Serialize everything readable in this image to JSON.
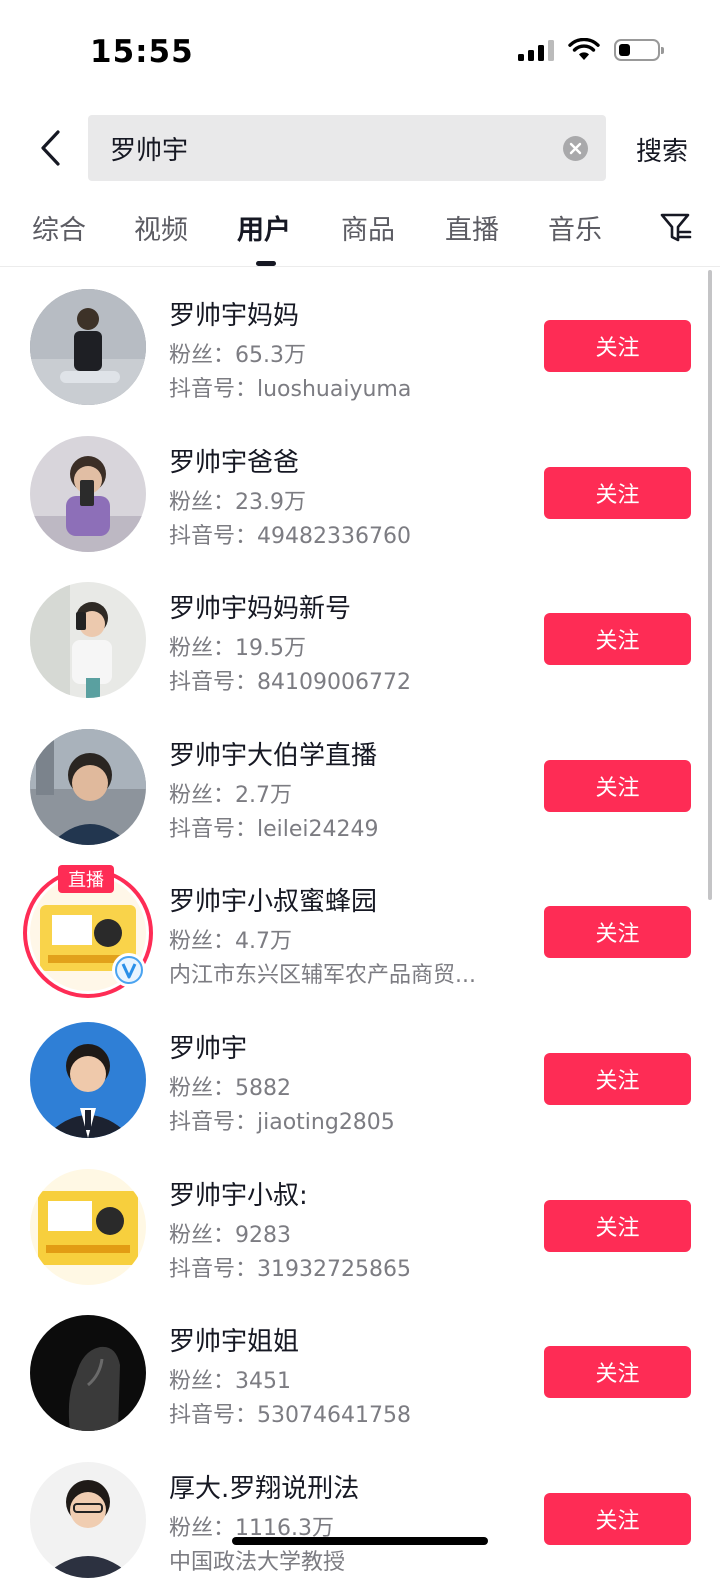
{
  "status": {
    "time": "15:55",
    "battery_level": 0.3
  },
  "search": {
    "query": "罗帅宇",
    "submit_label": "搜索"
  },
  "tabs": [
    {
      "label": "综合"
    },
    {
      "label": "视频"
    },
    {
      "label": "用户"
    },
    {
      "label": "商品"
    },
    {
      "label": "直播"
    },
    {
      "label": "音乐"
    }
  ],
  "active_tab": "用户",
  "users": [
    {
      "name": "罗帅宇妈妈",
      "fans": "粉丝：65.3万",
      "extra": "抖音号：luoshuaiyuma",
      "follow": "关注"
    },
    {
      "name": "罗帅宇爸爸",
      "fans": "粉丝：23.9万",
      "extra": "抖音号：49482336760",
      "follow": "关注"
    },
    {
      "name": "罗帅宇妈妈新号",
      "fans": "粉丝：19.5万",
      "extra": "抖音号：84109006772",
      "follow": "关注"
    },
    {
      "name": "罗帅宇大伯学直播",
      "fans": "粉丝：2.7万",
      "extra": "抖音号：leilei24249",
      "follow": "关注"
    },
    {
      "name": "罗帅宇小叔蜜蜂园",
      "fans": "粉丝：4.7万",
      "extra": "内江市东兴区辅军农产品商贸...",
      "follow": "关注",
      "live_label": "直播"
    },
    {
      "name": "罗帅宇",
      "fans": "粉丝：5882",
      "extra": "抖音号：jiaoting2805",
      "follow": "关注"
    },
    {
      "name": "罗帅宇小叔:",
      "fans": "粉丝：9283",
      "extra": "抖音号：31932725865",
      "follow": "关注"
    },
    {
      "name": "罗帅宇姐姐",
      "fans": "粉丝：3451",
      "extra": "抖音号：53074641758",
      "follow": "关注"
    },
    {
      "name": "厚大.罗翔说刑法",
      "fans": "粉丝：1116.3万",
      "extra": "中国政法大学教授",
      "follow": "关注"
    }
  ],
  "icons": {
    "back": "chevron-left-icon",
    "clear": "clear-icon",
    "filter": "filter-icon",
    "verified": "verified-icon"
  },
  "colors": {
    "accent": "#fe2c55",
    "text": "#161823",
    "muted": "#7c7c82"
  }
}
